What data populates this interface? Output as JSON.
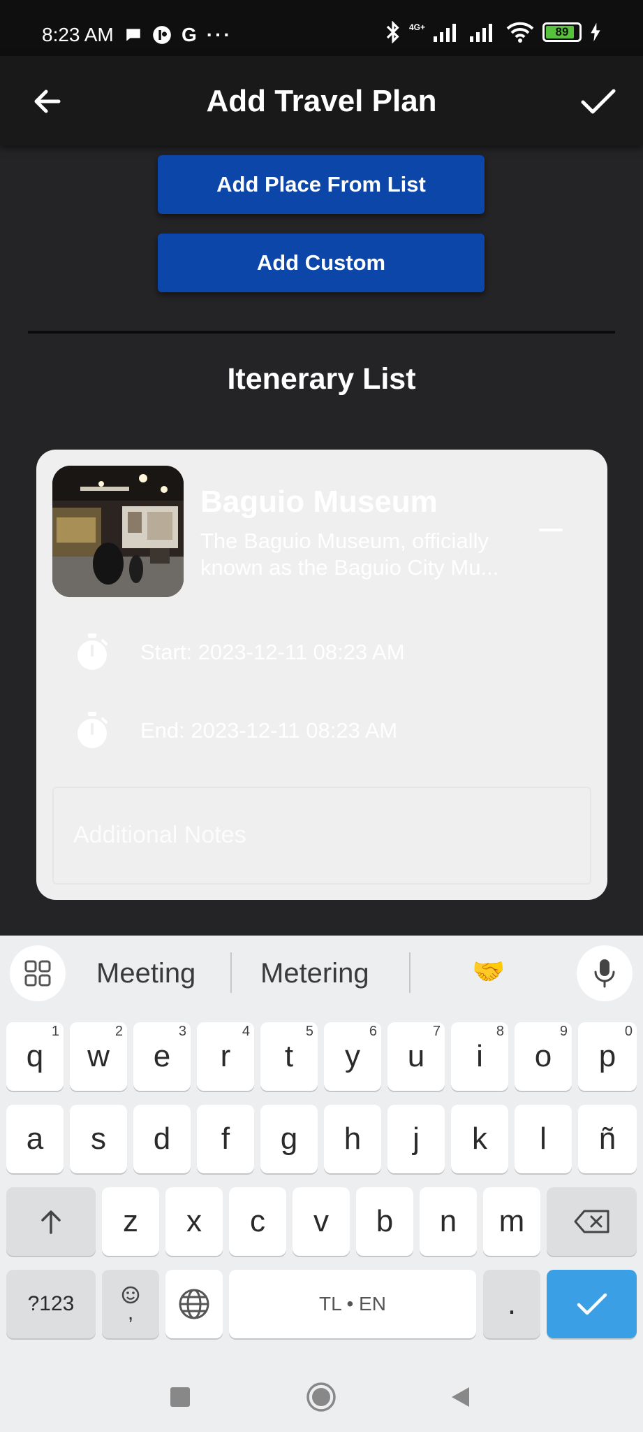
{
  "status_bar": {
    "time": "8:23 AM",
    "network": "4G+",
    "battery": "89"
  },
  "app_bar": {
    "title": "Add Travel Plan",
    "back_icon": "arrow-left-icon",
    "confirm_icon": "check-icon"
  },
  "actions": {
    "add_from_list": "Add Place From List",
    "add_custom": "Add Custom"
  },
  "section_title": "Itenerary List",
  "itinerary": [
    {
      "name": "Baguio Museum",
      "description_line1": "The Baguio Museum, officially",
      "description_line2": "known as the Baguio City Mu...",
      "start": "Start: 2023-12-11 08:23 AM",
      "end": "End: 2023-12-11 08:23 AM",
      "notes_placeholder": "Additional Notes"
    }
  ],
  "keyboard": {
    "suggestions": [
      "Meeting",
      "Metering"
    ],
    "emoji": "🤝",
    "row1": [
      "q",
      "w",
      "e",
      "r",
      "t",
      "y",
      "u",
      "i",
      "o",
      "p"
    ],
    "row1_nums": [
      "1",
      "2",
      "3",
      "4",
      "5",
      "6",
      "7",
      "8",
      "9",
      "0"
    ],
    "row2": [
      "a",
      "s",
      "d",
      "f",
      "g",
      "h",
      "j",
      "k",
      "l",
      "ñ"
    ],
    "row3": [
      "z",
      "x",
      "c",
      "v",
      "b",
      "n",
      "m"
    ],
    "symbols": "?123",
    "emoji_comma": ",",
    "space": "TL • EN",
    "period": "."
  },
  "colors": {
    "button_blue": "#0b46a8",
    "background": "#242325",
    "card": "#efefef",
    "enter_key": "#3a9fe4"
  }
}
